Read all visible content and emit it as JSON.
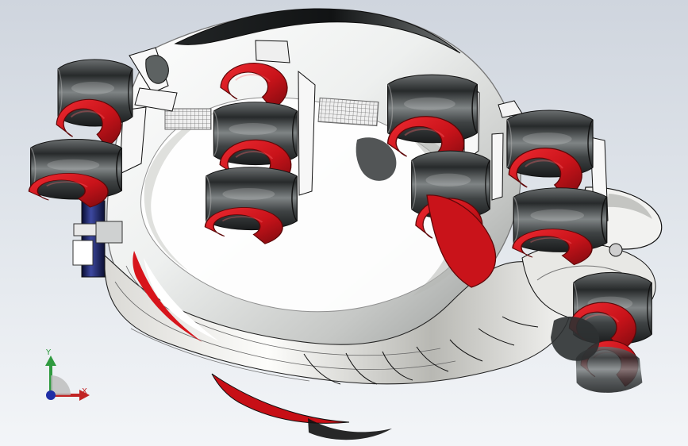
{
  "viewport": {
    "background_top": "#cfd5de",
    "background_bottom": "#f3f5f8"
  },
  "model": {
    "colors": {
      "red": "#c9131a",
      "dark_red": "#8f0d12",
      "rubber": "#4b4f50",
      "rubber_dark": "#222628",
      "white": "#f4f4f3",
      "silver": "#b5b8b8"
    },
    "icons": {
      "roller": "finger-roller",
      "bracket": "mounting-bracket",
      "mesh": "mesh-strip"
    }
  },
  "triad": {
    "y_label": "Y",
    "x_label": "X",
    "y_color": "#2f9a3f",
    "x_color": "#c12424",
    "origin_color": "#1f2ea6"
  }
}
